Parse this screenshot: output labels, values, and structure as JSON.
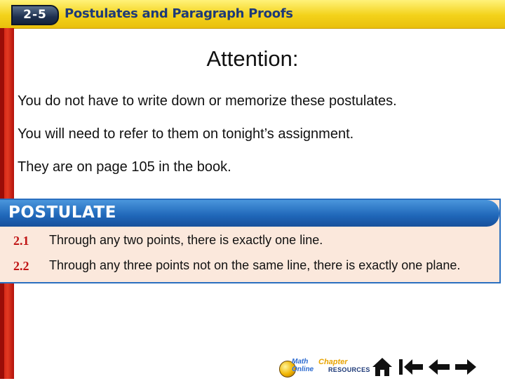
{
  "header": {
    "lesson_number": "2-5",
    "lesson_title": "Postulates and Paragraph Proofs"
  },
  "content": {
    "heading": "Attention:",
    "paragraphs": [
      "You do not have to write down or memorize these postulates.",
      "You will need to refer to them on tonight’s assignment.",
      "They are on page 105 in the book."
    ]
  },
  "postulate_box": {
    "title": "POSTULATE",
    "items": [
      {
        "number": "2.1",
        "text": "Through any two points, there is exactly one line."
      },
      {
        "number": "2.2",
        "text": "Through any three points not on the same line, there is exactly one plane."
      }
    ]
  },
  "nav": {
    "math_online": {
      "line1": "Math",
      "line2": "Online"
    },
    "chapter_resources": {
      "line1": "Chapter",
      "line2": "RESOURCES"
    },
    "icons": [
      "home-icon",
      "first-slide-icon",
      "previous-slide-icon",
      "next-slide-icon"
    ]
  },
  "colors": {
    "header_yellow": "#f3d21a",
    "left_border_red": "#d8261a",
    "postulate_blue": "#1f66b8",
    "postulate_bg": "#fbe8dc",
    "postulate_number_red": "#c01414"
  }
}
